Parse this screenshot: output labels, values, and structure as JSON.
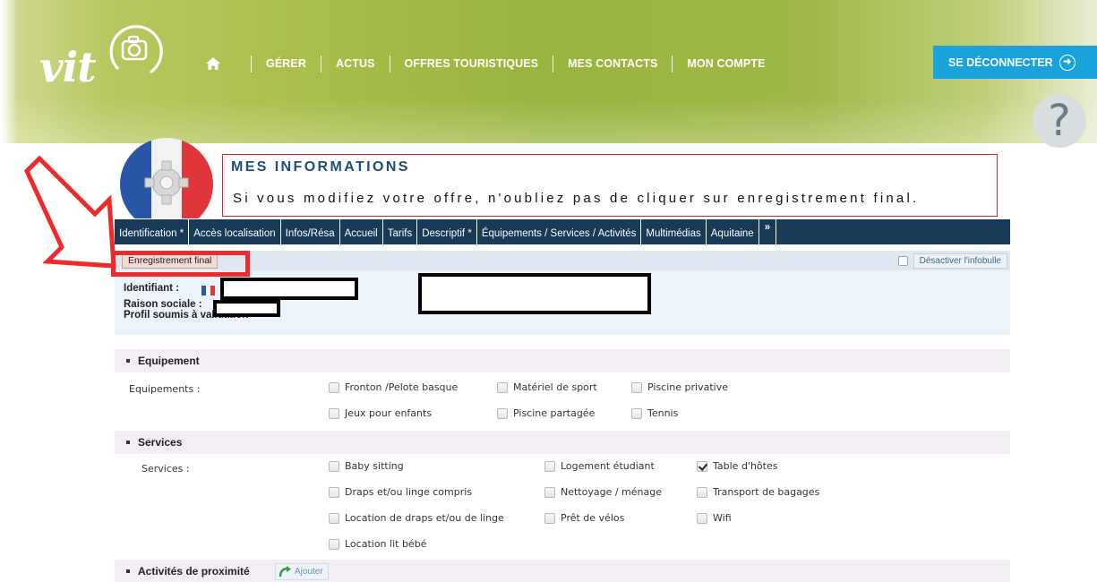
{
  "header": {
    "logo_text": "vit",
    "nav": [
      "GÉRER",
      "ACTUS",
      "OFFRES TOURISTIQUES",
      "MES CONTACTS",
      "MON COMPTE"
    ],
    "logout_label": "SE DÉCONNECTER",
    "help_label": "?"
  },
  "info": {
    "title": "MES INFORMATIONS",
    "message": "Si vous modifiez votre offre, n'oubliez pas de cliquer sur enregistrement final."
  },
  "tabs": [
    "Identification *",
    "Accès localisation",
    "Infos/Résa",
    "Accueil",
    "Tarifs",
    "Descriptif *",
    "Équipements / Services / Activités",
    "Multimédias",
    "Aquitaine",
    "»"
  ],
  "active_tab": "Équipements / Services / Activités",
  "toolbar": {
    "final_button": "Enregistrement final",
    "infobulle": "Désactiver l'infobulle"
  },
  "identity": {
    "identifiant_label": "Identifiant :",
    "raison_label": "Raison sociale :",
    "profil_text": "Profil soumis à validation"
  },
  "sections": {
    "equipement": {
      "title": "Equipement",
      "label": "Equipements :",
      "options": [
        {
          "label": "Fronton /Pelote basque",
          "checked": false
        },
        {
          "label": "Matériel de sport",
          "checked": false
        },
        {
          "label": "Piscine privative",
          "checked": false
        },
        {
          "label": "Jeux pour enfants",
          "checked": false
        },
        {
          "label": "Piscine partagée",
          "checked": false
        },
        {
          "label": "Tennis",
          "checked": false
        }
      ]
    },
    "services": {
      "title": "Services",
      "label": "Services :",
      "options": [
        {
          "label": "Baby sitting",
          "checked": false
        },
        {
          "label": "Logement étudiant",
          "checked": false
        },
        {
          "label": "Table d'hôtes",
          "checked": true
        },
        {
          "label": "Draps et/ou linge compris",
          "checked": false
        },
        {
          "label": "Nettoyage / ménage",
          "checked": false
        },
        {
          "label": "Transport de bagages",
          "checked": false
        },
        {
          "label": "Location de draps et/ou de linge",
          "checked": false
        },
        {
          "label": "Prêt de vélos",
          "checked": false
        },
        {
          "label": "Wifi",
          "checked": false
        },
        {
          "label": "Location lit bébé",
          "checked": false
        }
      ]
    },
    "activites": {
      "title": "Activités de proximité",
      "add_label": "Ajouter"
    }
  },
  "colors": {
    "nav_bar": "#163a57",
    "logout_bg": "#1aa3da",
    "highlight_red": "#ee2a2a",
    "info_title": "#1e4d77"
  }
}
